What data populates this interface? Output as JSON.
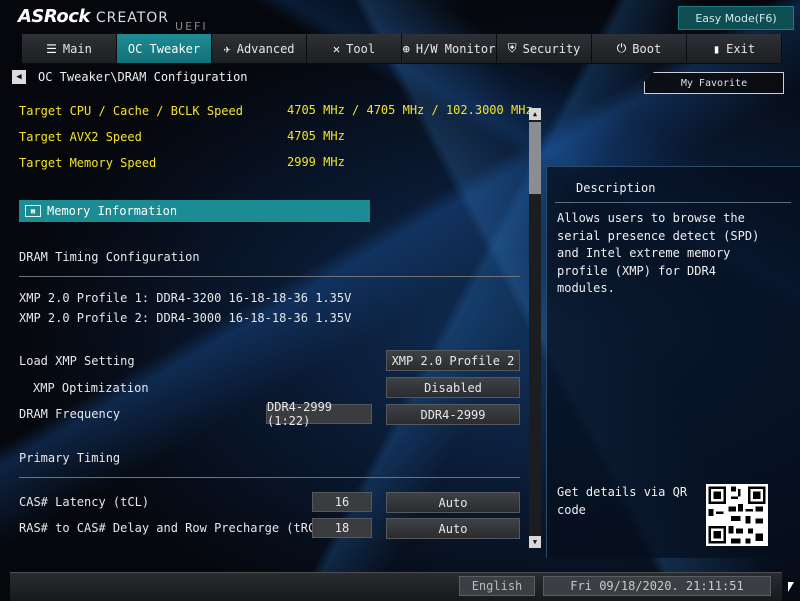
{
  "header": {
    "brand": "ASRock",
    "product": "CREATOR",
    "uefi": "UEFI",
    "easy_mode": "Easy Mode(F6)"
  },
  "tabs": [
    {
      "label": "Main",
      "icon": "list-icon"
    },
    {
      "label": "OC Tweaker",
      "icon": "oc-icon"
    },
    {
      "label": "Advanced",
      "icon": "plane-icon"
    },
    {
      "label": "Tool",
      "icon": "tools-icon"
    },
    {
      "label": "H/W Monitor",
      "icon": "monitor-icon"
    },
    {
      "label": "Security",
      "icon": "shield-icon"
    },
    {
      "label": "Boot",
      "icon": "power-icon"
    },
    {
      "label": "Exit",
      "icon": "exit-icon"
    }
  ],
  "active_tab": "OC Tweaker",
  "breadcrumb": "OC Tweaker\\DRAM Configuration",
  "my_favorite": "My Favorite",
  "targets": [
    {
      "label": "Target CPU / Cache / BCLK Speed",
      "value": "4705 MHz / 4705 MHz / 102.3000 MHz"
    },
    {
      "label": "Target AVX2 Speed",
      "value": "4705 MHz"
    },
    {
      "label": "Target Memory Speed",
      "value": "2999 MHz"
    }
  ],
  "memory_information": "Memory Information",
  "dram_timing_header": "DRAM Timing Configuration",
  "xmp_profiles": [
    "XMP 2.0 Profile 1: DDR4-3200 16-18-18-36 1.35V",
    "XMP 2.0 Profile 2: DDR4-3000 16-18-18-36 1.35V"
  ],
  "settings": {
    "load_xmp": {
      "label": "Load XMP Setting",
      "option": "XMP 2.0 Profile 2"
    },
    "xmp_opt": {
      "label": "XMP Optimization",
      "option": "Disabled"
    },
    "dram_freq": {
      "label": "DRAM Frequency",
      "current": "DDR4-2999 (1:22)",
      "option": "DDR4-2999"
    }
  },
  "primary_timing_header": "Primary Timing",
  "timings": {
    "cas": {
      "label": "CAS# Latency (tCL)",
      "current": "16",
      "option": "Auto"
    },
    "ras_cas": {
      "label": "RAS# to CAS# Delay and Row Precharge (tRCDtRP)",
      "current": "18",
      "option": "Auto"
    }
  },
  "description": {
    "title": "Description",
    "text": "Allows users to browse the serial presence detect (SPD) and Intel extreme memory profile (XMP) for DDR4 modules.",
    "qr_text": "Get details via QR code"
  },
  "footer": {
    "language": "English",
    "datetime": "Fri 09/18/2020. 21:11:51"
  }
}
